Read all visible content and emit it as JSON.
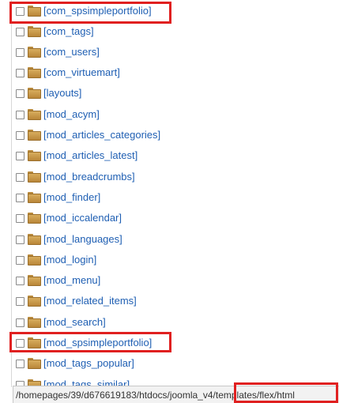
{
  "file_list": {
    "items": [
      {
        "label": "[com_spsimpleportfolio]"
      },
      {
        "label": "[com_tags]"
      },
      {
        "label": "[com_users]"
      },
      {
        "label": "[com_virtuemart]"
      },
      {
        "label": "[layouts]"
      },
      {
        "label": "[mod_acym]"
      },
      {
        "label": "[mod_articles_categories]"
      },
      {
        "label": "[mod_articles_latest]"
      },
      {
        "label": "[mod_breadcrumbs]"
      },
      {
        "label": "[mod_finder]"
      },
      {
        "label": "[mod_iccalendar]"
      },
      {
        "label": "[mod_languages]"
      },
      {
        "label": "[mod_login]"
      },
      {
        "label": "[mod_menu]"
      },
      {
        "label": "[mod_related_items]"
      },
      {
        "label": "[mod_search]"
      },
      {
        "label": "[mod_spsimpleportfolio]"
      },
      {
        "label": "[mod_tags_popular]"
      },
      {
        "label": "[mod_tags_similar]"
      }
    ]
  },
  "status_bar": {
    "path": "/homepages/39/d676619183/htdocs/joomla_v4/templates/flex/html"
  },
  "colors": {
    "link": "#1f5fb3",
    "highlight": "#e02020",
    "folder": "#c99a4a"
  },
  "icons": {
    "folder": "folder-icon",
    "checkbox": "checkbox"
  }
}
